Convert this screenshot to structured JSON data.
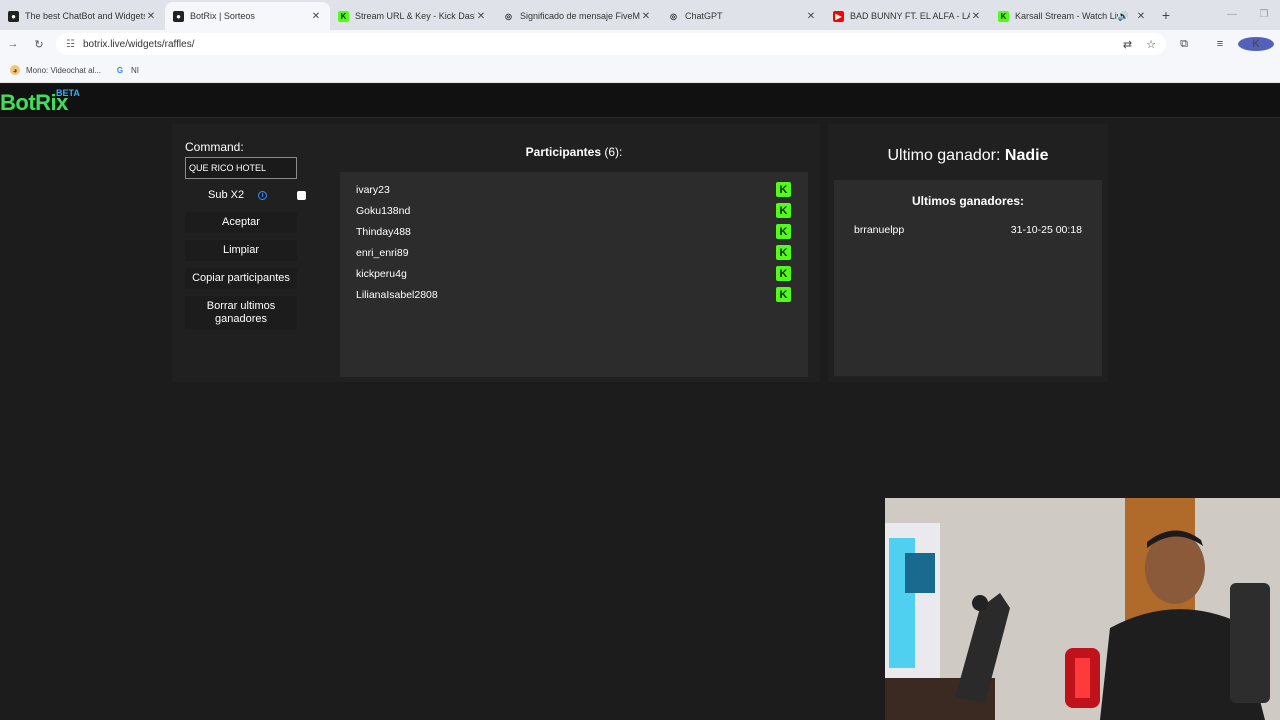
{
  "browser": {
    "tabs": [
      {
        "title": "The best ChatBot and Widgets",
        "icon": "github-icon",
        "color": "#222222",
        "glyph": "●"
      },
      {
        "title": "BotRix | Sorteos",
        "icon": "github-icon",
        "color": "#222222",
        "glyph": "●",
        "active": true
      },
      {
        "title": "Stream URL & Key - Kick Dashb",
        "icon": "kick-icon",
        "color": "#53fc18",
        "glyph": "K"
      },
      {
        "title": "Significado de mensaje FiveM",
        "icon": "chatgpt-icon",
        "color": "#dfe3e9",
        "glyph": "◎"
      },
      {
        "title": "ChatGPT",
        "icon": "chatgpt-icon",
        "color": "#dfe3e9",
        "glyph": "◎"
      },
      {
        "title": "BAD BUNNY FT. EL ALFA - LA R",
        "icon": "youtube-icon",
        "color": "#ff0000",
        "glyph": "▶"
      },
      {
        "title": "Karsall Stream - Watch Live",
        "icon": "kick-icon",
        "color": "#53fc18",
        "glyph": "K",
        "audio": true
      }
    ],
    "url": "botrix.live/widgets/raffles/",
    "bookmarks": [
      {
        "label": "Mono: Videochat al...",
        "icon": "monkey-icon"
      },
      {
        "label": "NI",
        "icon": "google-icon"
      }
    ],
    "profile_initial": "K"
  },
  "site": {
    "logo": "BotRix",
    "badge": "BETA"
  },
  "controls": {
    "command_label": "Command:",
    "command_value": "QUE RICO HOTEL",
    "sub_label": "Sub X2",
    "accept": "Aceptar",
    "clear": "Limpiar",
    "copy": "Copiar participantes",
    "delete_line1": "Borrar ultimos",
    "delete_line2": "ganadores"
  },
  "participants": {
    "title": "Participantes",
    "count": "(6):",
    "items": [
      "ivary23",
      "Goku138nd",
      "Thinday488",
      "enri_enri89",
      "kickperu4g",
      "LilianaIsabel2808"
    ]
  },
  "winners": {
    "last_label": "Ultimo ganador:",
    "last_value": "Nadie",
    "list_title": "Ultimos ganadores:",
    "rows": [
      {
        "name": "brranuelpp",
        "date": "31-10-25 00:18"
      }
    ]
  },
  "colors": {
    "accent_green": "#3ee05a",
    "kick_green": "#53fc18",
    "beta_blue": "#2db2ff"
  }
}
